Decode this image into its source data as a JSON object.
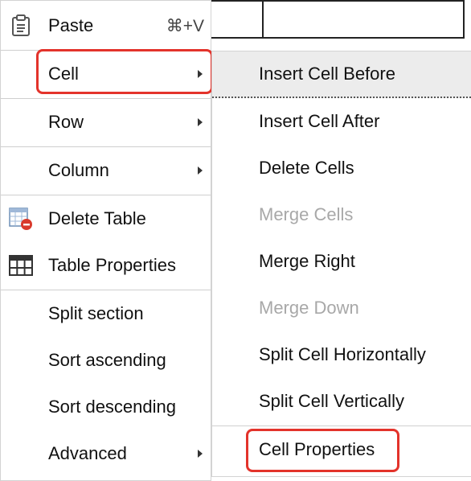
{
  "menu": {
    "items": [
      {
        "label": "Paste",
        "shortcut": "⌘+V",
        "icon": "clipboard-icon"
      },
      {
        "label": "Cell"
      },
      {
        "label": "Row"
      },
      {
        "label": "Column"
      },
      {
        "label": "Delete Table",
        "icon": "delete-table-icon"
      },
      {
        "label": "Table Properties",
        "icon": "table-grid-icon"
      },
      {
        "label": "Split section"
      },
      {
        "label": "Sort ascending"
      },
      {
        "label": "Sort descending"
      },
      {
        "label": "Advanced"
      }
    ]
  },
  "submenu": {
    "items": [
      {
        "label": "Insert Cell Before",
        "state": "hovered"
      },
      {
        "label": "Insert Cell After"
      },
      {
        "label": "Delete Cells"
      },
      {
        "label": "Merge Cells",
        "state": "disabled"
      },
      {
        "label": "Merge Right"
      },
      {
        "label": "Merge Down",
        "state": "disabled"
      },
      {
        "label": "Split Cell Horizontally"
      },
      {
        "label": "Split Cell Vertically"
      },
      {
        "label": "Cell Properties"
      }
    ]
  },
  "colors": {
    "highlight": "#e3332b",
    "hover_bg": "#ececec",
    "disabled_text": "#a8a8a8"
  }
}
